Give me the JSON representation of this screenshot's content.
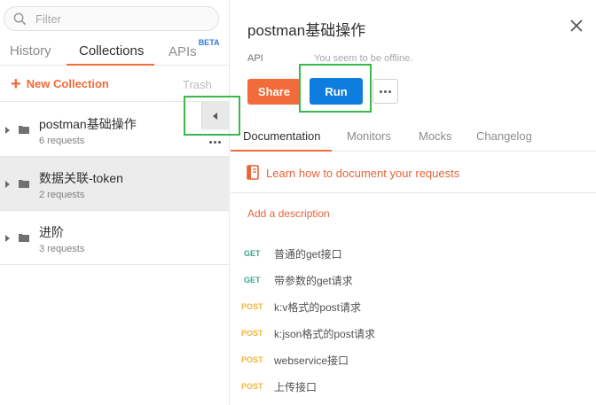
{
  "sidebar": {
    "search_placeholder": "Filter",
    "tabs": {
      "history": "History",
      "collections": "Collections",
      "apis": "APIs",
      "apis_badge": "BETA"
    },
    "new_collection": "New Collection",
    "trash": "Trash",
    "collections": [
      {
        "name": "postman基础操作",
        "count": "6 requests"
      },
      {
        "name": "数据关联-token",
        "count": "2 requests"
      },
      {
        "name": "进阶",
        "count": "3 requests"
      }
    ]
  },
  "panel": {
    "title": "postman基础操作",
    "api_label": "API",
    "offline_note": "You seem to be offline.",
    "share_label": "Share",
    "run_label": "Run",
    "tabs": {
      "documentation": "Documentation",
      "monitors": "Monitors",
      "mocks": "Mocks",
      "changelog": "Changelog"
    },
    "learn_link": "Learn how to document your requests",
    "add_description": "Add a description",
    "requests": [
      {
        "method": "GET",
        "name": "普通的get接口"
      },
      {
        "method": "GET",
        "name": "带参数的get请求"
      },
      {
        "method": "POST",
        "name": "k:v格式的post请求"
      },
      {
        "method": "POST",
        "name": "k:json格式的post请求"
      },
      {
        "method": "POST",
        "name": "webservice接口"
      },
      {
        "method": "POST",
        "name": "上传接口"
      }
    ]
  },
  "colors": {
    "accent": "#f26b3a",
    "run_button": "#0e7de0",
    "get": "#3aa38f",
    "post": "#f3b33c",
    "highlight": "#3bb84a"
  }
}
